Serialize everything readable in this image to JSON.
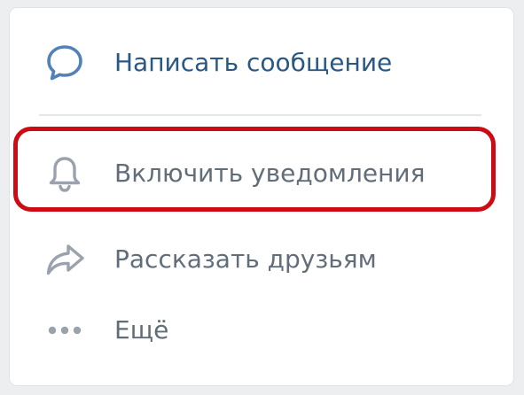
{
  "colors": {
    "accent": "#2a5885",
    "accent_icon": "#5181b8",
    "text_gray": "#626d7a",
    "icon_gray": "#99a2ad",
    "highlight_red": "#cc0b15",
    "card_bg": "#ffffff",
    "page_bg": "#edeef0"
  },
  "menu": {
    "items": [
      {
        "label": "Написать сообщение",
        "icon": "message-bubble-icon"
      },
      {
        "label": "Включить уведомления",
        "icon": "bell-icon"
      },
      {
        "label": "Рассказать друзьям",
        "icon": "share-arrow-icon"
      },
      {
        "label": "Ещё",
        "icon": "more-dots-icon"
      }
    ]
  }
}
